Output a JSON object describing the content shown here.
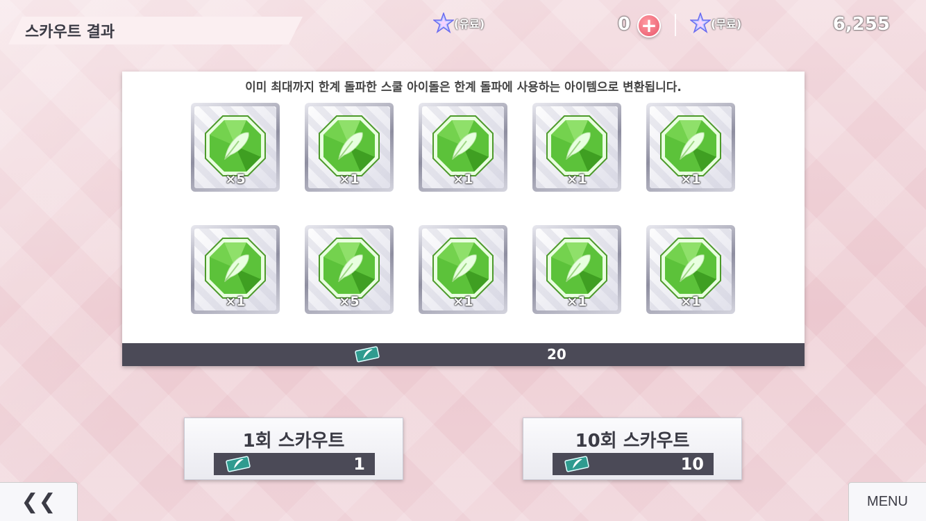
{
  "header": {
    "title": "스카우트 결과",
    "paid_tag": "(유료)",
    "paid_count": "0",
    "free_tag": "(무료)",
    "free_count": "6,255",
    "plus_label": "+"
  },
  "panel": {
    "notice": "이미 최대까지 한계 돌파한 스쿨 아이돌은 한계 돌파에 사용하는 아이템으로 변환됩니다.",
    "items": [
      {
        "qty": "×5",
        "icon": "feather-gem-icon"
      },
      {
        "qty": "×1",
        "icon": "feather-gem-icon"
      },
      {
        "qty": "×1",
        "icon": "feather-gem-icon"
      },
      {
        "qty": "×1",
        "icon": "feather-gem-icon"
      },
      {
        "qty": "×1",
        "icon": "feather-gem-icon"
      },
      {
        "qty": "×1",
        "icon": "feather-gem-icon"
      },
      {
        "qty": "×5",
        "icon": "feather-gem-icon"
      },
      {
        "qty": "×1",
        "icon": "feather-gem-icon"
      },
      {
        "qty": "×1",
        "icon": "feather-gem-icon"
      },
      {
        "qty": "×1",
        "icon": "feather-gem-icon"
      }
    ],
    "total": "20"
  },
  "buttons": {
    "scout1": {
      "label": "1회 스카우트",
      "cost": "1"
    },
    "scout10": {
      "label": "10회 스카우트",
      "cost": "10"
    },
    "back": "❮❮",
    "menu": "MENU"
  },
  "colors": {
    "gem": "#5cc23a",
    "panel_footer": "#4b4a57",
    "ticket": "#2f9b8f"
  }
}
